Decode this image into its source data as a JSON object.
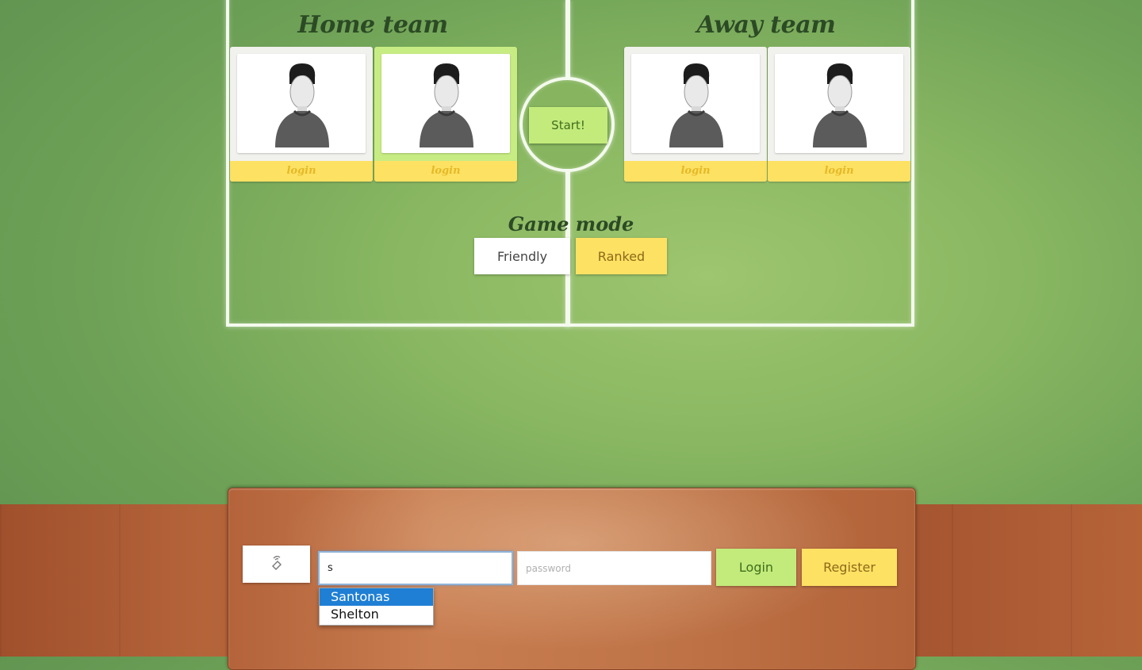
{
  "teams": {
    "home_title": "Home team",
    "away_title": "Away team"
  },
  "players": [
    {
      "team": "home",
      "login_label": "login",
      "active": false
    },
    {
      "team": "home",
      "login_label": "login",
      "active": true
    },
    {
      "team": "away",
      "login_label": "login",
      "active": false
    },
    {
      "team": "away",
      "login_label": "login",
      "active": false
    }
  ],
  "center": {
    "start_label": "Start!"
  },
  "game_mode": {
    "label": "Game mode",
    "options": [
      "Friendly",
      "Ranked"
    ]
  },
  "login_bar": {
    "nfc_icon": "nfc-icon",
    "username_value": "s",
    "password_placeholder": "password",
    "login_label": "Login",
    "register_label": "Register",
    "suggestions": [
      "Santonas",
      "Shelton"
    ],
    "selected_suggestion": "Santonas"
  },
  "colors": {
    "green_accent": "#c3eb7b",
    "yellow_accent": "#fde163",
    "field_line": "#f4faee"
  }
}
